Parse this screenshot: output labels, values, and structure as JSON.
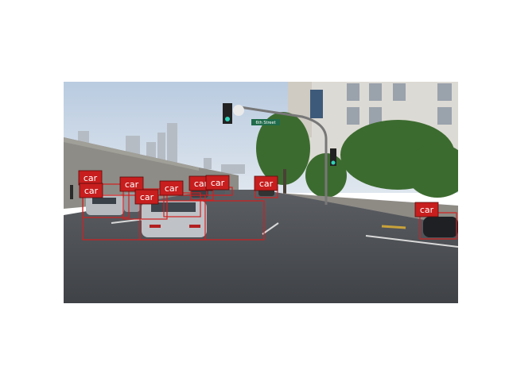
{
  "detections": [
    {
      "label": "car"
    },
    {
      "label": "car"
    },
    {
      "label": "car"
    },
    {
      "label": "car"
    },
    {
      "label": "car"
    },
    {
      "label": "car"
    },
    {
      "label": "car"
    },
    {
      "label": "car"
    },
    {
      "label": "car"
    }
  ],
  "street_sign": "6th Street",
  "colors": {
    "box": "#d32020",
    "label_bg": "#c81e1e",
    "label_text": "#ffffff"
  }
}
